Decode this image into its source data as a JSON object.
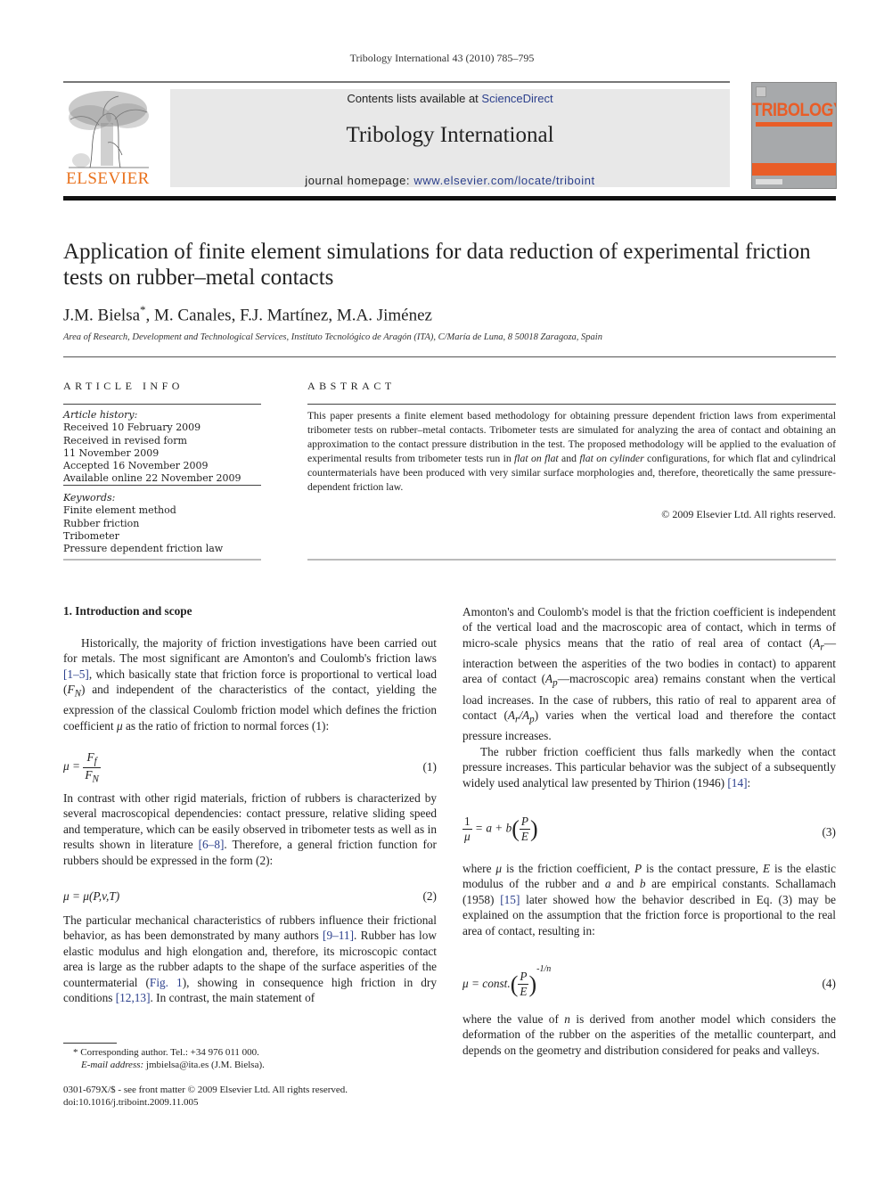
{
  "running_head": "Tribology International 43 (2010) 785–795",
  "header": {
    "publisher_logo_text": "ELSEVIER",
    "contents_prefix": "Contents lists available at ",
    "contents_link": "ScienceDirect",
    "journal_title": "Tribology International",
    "homepage_prefix": "journal homepage: ",
    "homepage_link": "www.elsevier.com/locate/triboint",
    "cover_title": "TRIBOLOGY",
    "colors": {
      "orange": "#e9711c",
      "link": "#2b3f8c",
      "banner_bg": "#e8e8e8"
    }
  },
  "article": {
    "title": "Application of finite element simulations for data reduction of experimental friction tests on rubber–metal contacts",
    "authors": [
      {
        "name": "J.M. Bielsa",
        "mark": "*"
      },
      {
        "name": "M. Canales"
      },
      {
        "name": "F.J. Martínez"
      },
      {
        "name": "M.A. Jiménez"
      }
    ],
    "affiliation": "Area of Research, Development and Technological Services, Instituto Tecnológico de Aragón (ITA), C/María de Luna, 8 50018 Zaragoza, Spain"
  },
  "article_info": {
    "heading": "ARTICLE INFO",
    "history_label": "Article history:",
    "history": [
      "Received 10 February 2009",
      "Received in revised form",
      "11 November 2009",
      "Accepted 16 November 2009",
      "Available online 22 November 2009"
    ],
    "keywords_label": "Keywords:",
    "keywords": [
      "Finite element method",
      "Rubber friction",
      "Tribometer",
      "Pressure dependent friction law"
    ]
  },
  "abstract": {
    "heading": "ABSTRACT",
    "part1": "This paper presents a finite element based methodology for obtaining pressure dependent friction laws from experimental tribometer tests on rubber–metal contacts. Tribometer tests are simulated for analyzing the area of contact and obtaining an approximation to the contact pressure distribution in the test. The proposed methodology will be applied to the evaluation of experimental results from tribometer tests run in ",
    "italic1": "flat on flat",
    "part2": " and ",
    "italic2": "flat on cylinder",
    "part3": " configurations, for which flat and cylindrical countermaterials have been produced with very similar surface morphologies and, therefore, theoretically the same pressure-dependent friction law.",
    "copyright": "© 2009 Elsevier Ltd. All rights reserved."
  },
  "body": {
    "section_title": "1.  Introduction and scope",
    "left": {
      "p1a": "Historically, the majority of friction investigations have been carried out for metals. The most significant are Amonton's and Coulomb's friction laws ",
      "ref1": "[1–5]",
      "p1b": ", which basically state that friction force is proportional to vertical load (",
      "p1var": "F",
      "p1sub": "N",
      "p1c": ") and independent of the characteristics of the contact, yielding the expression of the classical Coulomb friction model which defines the friction coefficient ",
      "p1mu": "μ",
      "p1d": " as the ratio of friction to normal forces (1):",
      "eq1_lhs": "μ =",
      "eq1_num": "F",
      "eq1_num_sub": "f",
      "eq1_den": "F",
      "eq1_den_sub": "N",
      "eq1_no": "(1)",
      "p2a": "In contrast with other rigid materials, friction of rubbers is characterized by several macroscopical dependencies: contact pressure, relative sliding speed and temperature, which can be easily observed in tribometer tests as well as in results shown in literature ",
      "ref2": "[6–8]",
      "p2b": ". Therefore, a general friction function for rubbers should be expressed in the form (2):",
      "eq2": "μ = μ(P,v,T)",
      "eq2_no": "(2)",
      "p3a": "The particular mechanical characteristics of rubbers influence their frictional behavior, as has been demonstrated by many authors ",
      "ref3": "[9–11]",
      "p3b": ". Rubber has low elastic modulus and high elongation and, therefore, its microscopic contact area is large as the rubber adapts to the shape of the surface asperities of the countermaterial (",
      "ref_fig": "Fig. 1",
      "p3c": "), showing in consequence high friction in dry conditions ",
      "ref4": "[12,13]",
      "p3d": ". In contrast, the main statement of"
    },
    "right": {
      "p1a": "Amonton's and Coulomb's model is that the friction coefficient is independent of the vertical load and the macroscopic area of contact, which in terms of micro-scale physics means that the ratio of real area of contact (",
      "ar": "A",
      "ar_sub": "r",
      "p1b": "—interaction between the asperities of the two bodies in contact) to apparent area of contact (",
      "ap": "A",
      "ap_sub": "p",
      "p1c": "—macroscopic area) remains constant when the vertical load increases. In the case of rubbers, this ratio of real to apparent area of contact (",
      "ratio": "A",
      "ratio_sub1": "r",
      "ratio_mid": "/A",
      "ratio_sub2": "p",
      "p1d": ") varies when the vertical load and therefore the contact pressure increases.",
      "p2a": "The rubber friction coefficient thus falls markedly when the contact pressure increases. This particular behavior was the subject of a subsequently widely used analytical law presented by Thirion (1946) ",
      "ref5": "[14]",
      "p2b": ":",
      "eq3_num": "1",
      "eq3_den": "μ",
      "eq3_mid": "= a + b",
      "eq3_fnum": "P",
      "eq3_fden": "E",
      "eq3_no": "(3)",
      "p3a": "where ",
      "p3mu": "μ",
      "p3b": " is the friction coefficient, ",
      "p3P": "P",
      "p3c": " is the contact pressure, ",
      "p3E": "E",
      "p3d": " is the elastic modulus of the rubber and ",
      "p3a_var": "a",
      "p3e": " and ",
      "p3b_var": "b",
      "p3f": " are empirical constants. Schallamach (1958) ",
      "ref6": "[15]",
      "p3g": " later showed how the behavior described in Eq. (3) may be explained on the assumption that the friction force is proportional to the real area of contact, resulting in:",
      "eq4_lhs": "μ = const.",
      "eq4_fnum": "P",
      "eq4_fden": "E",
      "eq4_exp": "-1/n",
      "eq4_no": "(4)",
      "p4a": "where the value of ",
      "p4n": "n",
      "p4b": " is derived from another model which considers the deformation of the rubber on the asperities of the metallic counterpart, and depends on the geometry and distribution considered for peaks and valleys."
    }
  },
  "footnotes": {
    "corresponding": "* Corresponding author. Tel.: +34 976 011 000.",
    "email_label": "E-mail address:",
    "email": " jmbielsa@ita.es (J.M. Bielsa).",
    "issn": "0301-679X/$ - see front matter © 2009 Elsevier Ltd. All rights reserved.",
    "doi": "doi:10.1016/j.triboint.2009.11.005"
  }
}
